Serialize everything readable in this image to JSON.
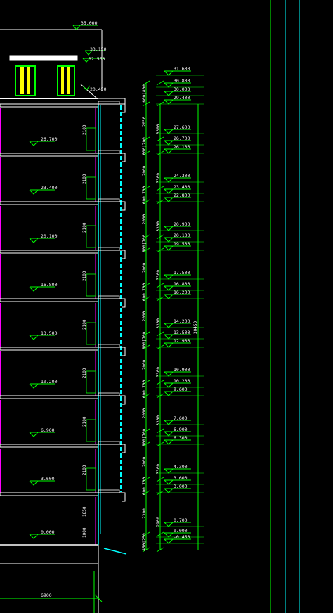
{
  "title_elevation": "35.000",
  "roof_elevations": [
    "33.150",
    "32.550"
  ],
  "eave_label": "20.450",
  "floor_labels": [
    "26.700",
    "23.400",
    "20.100",
    "16.800",
    "13.500",
    "10.200",
    "6.900",
    "3.600",
    "0.000"
  ],
  "window_height_labels": [
    "2100",
    "2100",
    "2100",
    "2100",
    "2100",
    "2100",
    "2100",
    "2100",
    "1850",
    "1000"
  ],
  "right_elevations": [
    "31.600",
    "30.800",
    "30.000",
    "29.400",
    "27.600",
    "26.700",
    "26.100",
    "24.300",
    "23.400",
    "22.800",
    "20.900",
    "20.100",
    "19.500",
    "17.500",
    "16.800",
    "16.200",
    "14.200",
    "13.500",
    "12.900",
    "10.900",
    "10.200",
    "9.600",
    "7.600",
    "6.900",
    "6.300",
    "4.300",
    "3.600",
    "3.000",
    "0.700",
    "0.000",
    "-0.450"
  ],
  "left_dim_segments": [
    "600|800",
    "2050",
    "600|700",
    "2000",
    "600|700",
    "2000",
    "600|700",
    "2000",
    "600|700",
    "2000",
    "600|700",
    "2000",
    "600|700",
    "2000",
    "600|700",
    "2000",
    "600|700",
    "2300",
    "450|250"
  ],
  "mid_dim_segments": [
    "3300",
    "3300",
    "3300",
    "3300",
    "3300",
    "3300",
    "3300",
    "3300",
    "2900"
  ],
  "overall_height": "30450",
  "bottom_width": "6900",
  "colors": {
    "line": "#00ff00",
    "text": "#ffffff",
    "wall": "#ff00ff",
    "glass": "#00ffff",
    "frame": "#ffff00"
  }
}
